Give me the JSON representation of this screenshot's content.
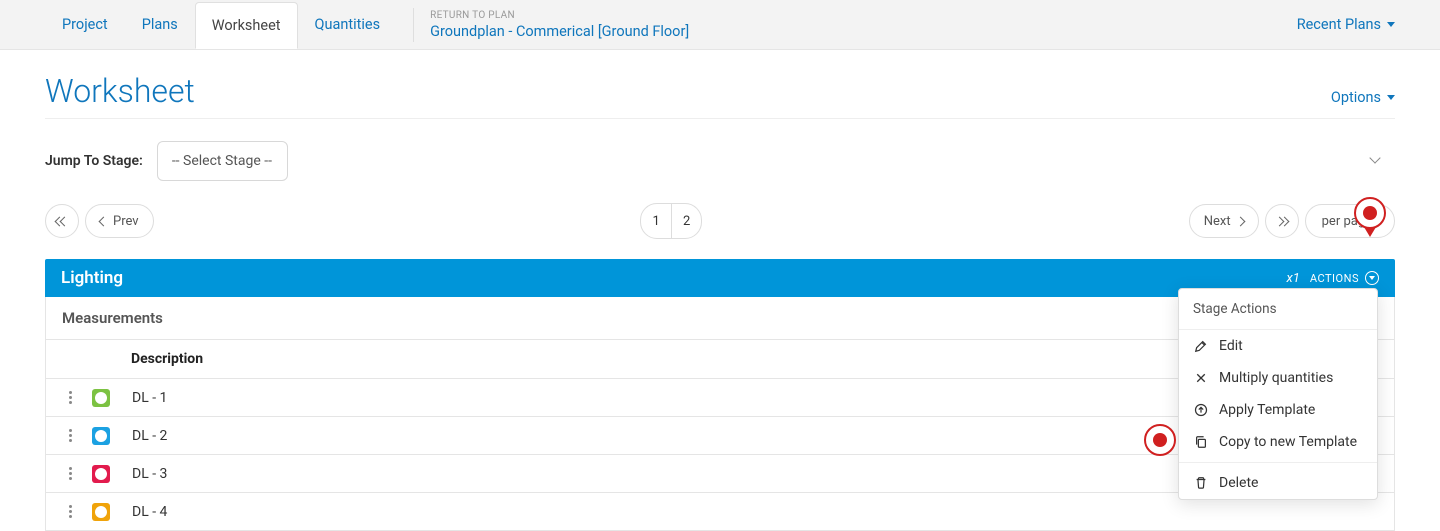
{
  "tabs": [
    "Project",
    "Plans",
    "Worksheet",
    "Quantities"
  ],
  "active_tab": "Worksheet",
  "return": {
    "label": "RETURN TO PLAN",
    "link": "Groundplan - Commerical [Ground Floor]"
  },
  "recent_plans": "Recent Plans",
  "page_title": "Worksheet",
  "options": "Options",
  "jump_label": "Jump To Stage:",
  "stage_placeholder": "-- Select Stage --",
  "pager": {
    "prev": "Prev",
    "next": "Next",
    "pages": [
      "1",
      "2"
    ],
    "current": "1",
    "per_page": "per page"
  },
  "stage": {
    "name": "Lighting",
    "multiplier": "x1",
    "actions_label": "ACTIONS",
    "section": "Measurements",
    "description_header": "Description",
    "rows": [
      {
        "label": "DL - 1",
        "color": "#7cc242"
      },
      {
        "label": "DL - 2",
        "color": "#1ba1e2"
      },
      {
        "label": "DL - 3",
        "color": "#e21b4d"
      },
      {
        "label": "DL - 4",
        "color": "#f0a30a"
      }
    ]
  },
  "popup": {
    "header": "Stage Actions",
    "items": {
      "edit": "Edit",
      "multiply": "Multiply quantities",
      "apply": "Apply Template",
      "copy": "Copy to new Template",
      "delete": "Delete"
    }
  }
}
